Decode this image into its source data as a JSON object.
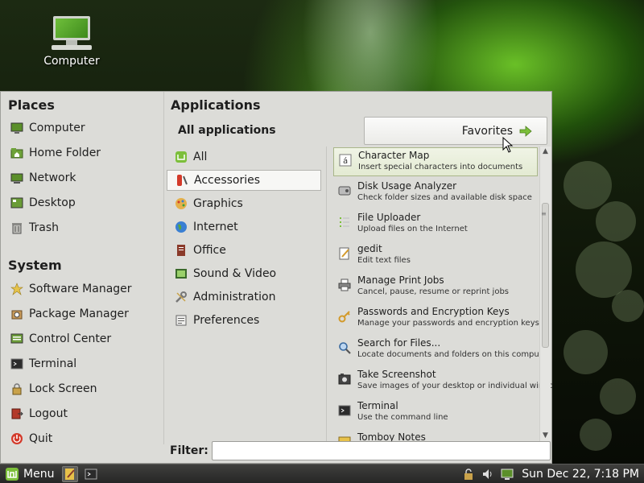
{
  "desktop": {
    "computer_label": "Computer"
  },
  "menu": {
    "places_title": "Places",
    "places": [
      {
        "label": "Computer",
        "icon": "computer-icon"
      },
      {
        "label": "Home Folder",
        "icon": "home-folder-icon"
      },
      {
        "label": "Network",
        "icon": "network-icon"
      },
      {
        "label": "Desktop",
        "icon": "desktop-icon"
      },
      {
        "label": "Trash",
        "icon": "trash-icon"
      }
    ],
    "system_title": "System",
    "system": [
      {
        "label": "Software Manager",
        "icon": "software-manager-icon"
      },
      {
        "label": "Package Manager",
        "icon": "package-manager-icon"
      },
      {
        "label": "Control Center",
        "icon": "control-center-icon"
      },
      {
        "label": "Terminal",
        "icon": "terminal-icon"
      },
      {
        "label": "Lock Screen",
        "icon": "lock-screen-icon"
      },
      {
        "label": "Logout",
        "icon": "logout-icon"
      },
      {
        "label": "Quit",
        "icon": "quit-icon"
      }
    ],
    "applications_title": "Applications",
    "all_applications_label": "All applications",
    "favorites_label": "Favorites",
    "categories": [
      {
        "label": "All",
        "icon": "all-icon"
      },
      {
        "label": "Accessories",
        "icon": "accessories-icon",
        "selected": true
      },
      {
        "label": "Graphics",
        "icon": "graphics-icon"
      },
      {
        "label": "Internet",
        "icon": "internet-icon"
      },
      {
        "label": "Office",
        "icon": "office-icon"
      },
      {
        "label": "Sound & Video",
        "icon": "sound-video-icon"
      },
      {
        "label": "Administration",
        "icon": "administration-icon"
      },
      {
        "label": "Preferences",
        "icon": "preferences-icon"
      }
    ],
    "apps": [
      {
        "name": "Character Map",
        "desc": "Insert special characters into documents",
        "icon": "character-map-icon"
      },
      {
        "name": "Disk Usage Analyzer",
        "desc": "Check folder sizes and available disk space",
        "icon": "disk-usage-icon"
      },
      {
        "name": "File Uploader",
        "desc": "Upload files on the Internet",
        "icon": "file-uploader-icon"
      },
      {
        "name": "gedit",
        "desc": "Edit text files",
        "icon": "gedit-icon"
      },
      {
        "name": "Manage Print Jobs",
        "desc": "Cancel, pause, resume or reprint jobs",
        "icon": "printer-icon"
      },
      {
        "name": "Passwords and Encryption Keys",
        "desc": "Manage your passwords and encryption keys",
        "icon": "keys-icon"
      },
      {
        "name": "Search for Files...",
        "desc": "Locate documents and folders on this computer by...",
        "icon": "search-icon"
      },
      {
        "name": "Take Screenshot",
        "desc": "Save images of your desktop or individual windows",
        "icon": "screenshot-icon"
      },
      {
        "name": "Terminal",
        "desc": "Use the command line",
        "icon": "terminal-icon"
      },
      {
        "name": "Tomboy Notes",
        "desc": "",
        "icon": "notes-icon"
      }
    ],
    "filter_label": "Filter:",
    "filter_value": ""
  },
  "panel": {
    "menu_label": "Menu",
    "clock": "Sun Dec 22,  7:18 PM"
  },
  "colors": {
    "menu_bg": "#dcdcd8",
    "mint_green": "#7cbf3a",
    "panel_bg": "#2f2f2e"
  }
}
